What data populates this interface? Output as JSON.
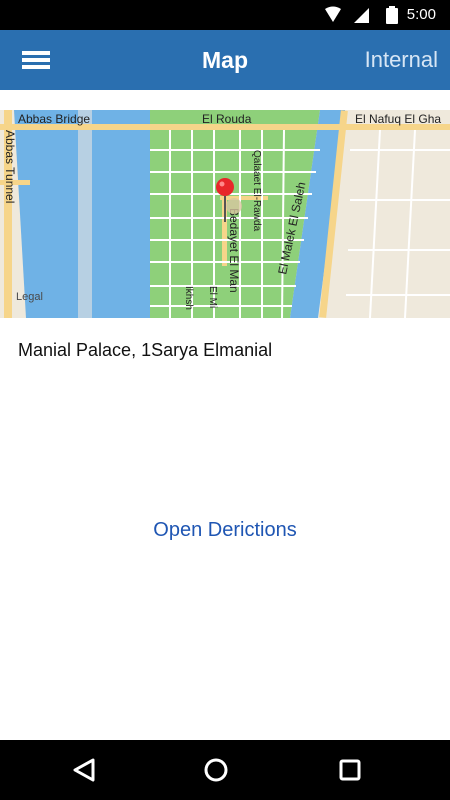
{
  "status_bar": {
    "time": "5:00"
  },
  "app_bar": {
    "title": "Map",
    "action_label": "Internal"
  },
  "map": {
    "labels": {
      "abbas_bridge": "Abbas Bridge",
      "el_rouda": "El Rouda",
      "el_nafuq": "El Nafuq El Gha",
      "abbas_tunnel": "Abbas Tunnel",
      "qalaaet_el_rawda": "Qalaaet El-Rawda",
      "bedayet_el_man": "Bedayet El Man",
      "el_malek_el_saleh": "El Malek El Saleh",
      "el_mi": "El Mi",
      "ikhsh": "Ikhsh",
      "legal": "Legal"
    }
  },
  "location": {
    "address": "Manial Palace, 1Sarya Elmanial"
  },
  "actions": {
    "open_directions": "Open Derictions"
  },
  "colors": {
    "app_bar": "#2a6fb0",
    "link": "#1f56b3",
    "pin": "#e8272a",
    "water": "#6fb2e6",
    "park": "#8ed07a"
  }
}
